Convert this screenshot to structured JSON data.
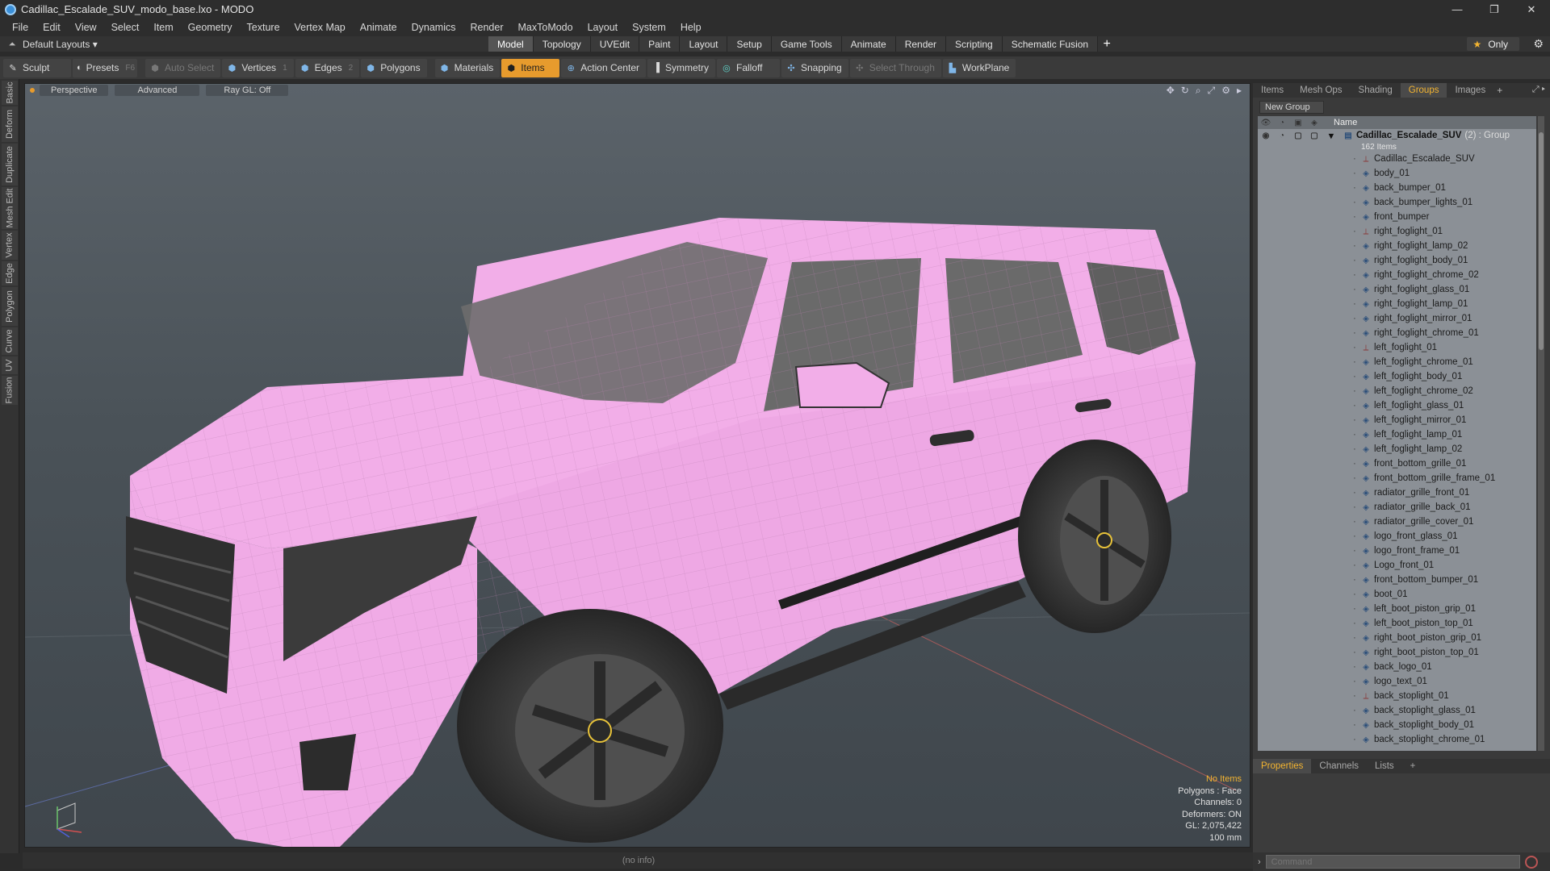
{
  "window": {
    "title": "Cadillac_Escalade_SUV_modo_base.lxo - MODO",
    "controls": [
      "—",
      "❐",
      "✕"
    ]
  },
  "menus": [
    "File",
    "Edit",
    "View",
    "Select",
    "Item",
    "Geometry",
    "Texture",
    "Vertex Map",
    "Animate",
    "Dynamics",
    "Render",
    "MaxToModo",
    "Layout",
    "System",
    "Help"
  ],
  "layout": {
    "selector": "Default Layouts ▾",
    "tabs": [
      "Model",
      "Topology",
      "UVEdit",
      "Paint",
      "Layout",
      "Setup",
      "Game Tools",
      "Animate",
      "Render",
      "Scripting",
      "Schematic Fusion"
    ],
    "active_tab": "Model",
    "only_label": "Only"
  },
  "toolbar": {
    "sculpt": "Sculpt",
    "presets": "Presets",
    "presets_key": "F6",
    "auto_select": "Auto Select",
    "vertices": "Vertices",
    "vertices_key": "1",
    "edges": "Edges",
    "edges_key": "2",
    "polygons": "Polygons",
    "materials": "Materials",
    "items": "Items",
    "action_center": "Action Center",
    "symmetry": "Symmetry",
    "falloff": "Falloff",
    "snapping": "Snapping",
    "select_through": "Select Through",
    "workplane": "WorkPlane"
  },
  "left_tabs": [
    "Basic",
    "Deform",
    "Duplicate",
    "Mesh Edit",
    "Vertex",
    "Edge",
    "Polygon",
    "Curve",
    "UV",
    "Fusion"
  ],
  "viewport": {
    "view_mode": "Perspective",
    "shading": "Advanced",
    "raygl": "Ray GL: Off",
    "stats": {
      "selection": "No Items",
      "polygons": "Polygons : Face",
      "channels": "Channels: 0",
      "deformers": "Deformers: ON",
      "gl": "GL: 2,075,422",
      "grid": "100 mm"
    },
    "colors": {
      "body": "#f2aee8",
      "tire": "#2b2b2b",
      "accent": "#e79b2d"
    }
  },
  "status": {
    "info": "(no info)"
  },
  "right_panel": {
    "tabs": [
      "Items",
      "Mesh Ops",
      "Shading",
      "Groups",
      "Images"
    ],
    "active_tab": "Groups",
    "new_group": "New Group",
    "column_name": "Name",
    "group": {
      "name": "Cadillac_Escalade_SUV",
      "suffix": "(2) : Group",
      "count": "162 Items"
    },
    "items": [
      {
        "name": "Cadillac_Escalade_SUV",
        "icon": "locator-icon"
      },
      {
        "name": "body_01",
        "icon": "mesh-icon"
      },
      {
        "name": "back_bumper_01",
        "icon": "mesh-icon"
      },
      {
        "name": "back_bumper_lights_01",
        "icon": "mesh-icon"
      },
      {
        "name": "front_bumper",
        "icon": "mesh-icon"
      },
      {
        "name": "right_foglight_01",
        "icon": "locator-icon"
      },
      {
        "name": "right_foglight_lamp_02",
        "icon": "mesh-icon"
      },
      {
        "name": "right_foglight_body_01",
        "icon": "mesh-icon"
      },
      {
        "name": "right_foglight_chrome_02",
        "icon": "mesh-icon"
      },
      {
        "name": "right_foglight_glass_01",
        "icon": "mesh-icon"
      },
      {
        "name": "right_foglight_lamp_01",
        "icon": "mesh-icon"
      },
      {
        "name": "right_foglight_mirror_01",
        "icon": "mesh-icon"
      },
      {
        "name": "right_foglight_chrome_01",
        "icon": "mesh-icon"
      },
      {
        "name": "left_foglight_01",
        "icon": "locator-icon"
      },
      {
        "name": "left_foglight_chrome_01",
        "icon": "mesh-icon"
      },
      {
        "name": "left_foglight_body_01",
        "icon": "mesh-icon"
      },
      {
        "name": "left_foglight_chrome_02",
        "icon": "mesh-icon"
      },
      {
        "name": "left_foglight_glass_01",
        "icon": "mesh-icon"
      },
      {
        "name": "left_foglight_mirror_01",
        "icon": "mesh-icon"
      },
      {
        "name": "left_foglight_lamp_01",
        "icon": "mesh-icon"
      },
      {
        "name": "left_foglight_lamp_02",
        "icon": "mesh-icon"
      },
      {
        "name": "front_bottom_grille_01",
        "icon": "mesh-icon"
      },
      {
        "name": "front_bottom_grille_frame_01",
        "icon": "mesh-icon"
      },
      {
        "name": "radiator_grille_front_01",
        "icon": "mesh-icon"
      },
      {
        "name": "radiator_grille_back_01",
        "icon": "mesh-icon"
      },
      {
        "name": "radiator_grille_cover_01",
        "icon": "mesh-icon"
      },
      {
        "name": "logo_front_glass_01",
        "icon": "mesh-icon"
      },
      {
        "name": "logo_front_frame_01",
        "icon": "mesh-icon"
      },
      {
        "name": "Logo_front_01",
        "icon": "mesh-icon"
      },
      {
        "name": "front_bottom_bumper_01",
        "icon": "mesh-icon"
      },
      {
        "name": "boot_01",
        "icon": "mesh-icon"
      },
      {
        "name": "left_boot_piston_grip_01",
        "icon": "mesh-icon"
      },
      {
        "name": "left_boot_piston_top_01",
        "icon": "mesh-icon"
      },
      {
        "name": "right_boot_piston_grip_01",
        "icon": "mesh-icon"
      },
      {
        "name": "right_boot_piston_top_01",
        "icon": "mesh-icon"
      },
      {
        "name": "back_logo_01",
        "icon": "mesh-icon"
      },
      {
        "name": "logo_text_01",
        "icon": "mesh-icon"
      },
      {
        "name": "back_stoplight_01",
        "icon": "locator-icon"
      },
      {
        "name": "back_stoplight_glass_01",
        "icon": "mesh-icon"
      },
      {
        "name": "back_stoplight_body_01",
        "icon": "mesh-icon"
      },
      {
        "name": "back_stoplight_chrome_01",
        "icon": "mesh-icon"
      }
    ]
  },
  "properties": {
    "tabs": [
      "Properties",
      "Channels",
      "Lists"
    ],
    "active_tab": "Properties"
  },
  "command": {
    "placeholder": "Command"
  }
}
